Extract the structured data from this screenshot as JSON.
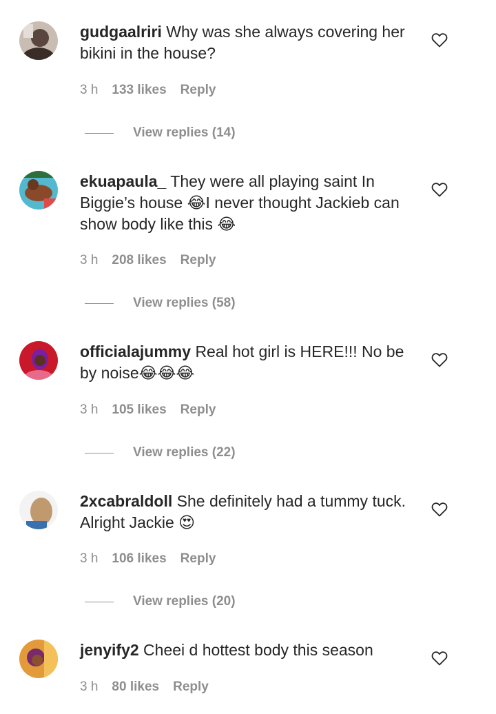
{
  "comments": [
    {
      "username": "gudgaalriri",
      "text": "Why was she always covering her bikini in the house?",
      "time": "3 h",
      "likes": "133 likes",
      "reply_label": "Reply",
      "view_replies": "View replies (14)",
      "avatar_colors": [
        "#b9a9a0",
        "#3a2d28",
        "#e0d6cf"
      ]
    },
    {
      "username": "ekuapaula_",
      "text": "They were all playing saint In Biggie’s house 😂I never thought Jackieb can show body like this 😂",
      "time": "3 h",
      "likes": "208 likes",
      "reply_label": "Reply",
      "view_replies": "View replies (58)",
      "avatar_colors": [
        "#4fb3c8",
        "#8a4a2a",
        "#2d7fa0"
      ]
    },
    {
      "username": "officialajummy",
      "text": "Real hot girl is HERE!!! No be by noise😂😂😂",
      "time": "3 h",
      "likes": "105 likes",
      "reply_label": "Reply",
      "view_replies": "View replies (22)",
      "avatar_colors": [
        "#d0202a",
        "#7a1fa0",
        "#f07a90"
      ]
    },
    {
      "username": "2xcabraldoll",
      "text": "She definitely had a tummy tuck. Alright Jackie 😍",
      "time": "3 h",
      "likes": "106 likes",
      "reply_label": "Reply",
      "view_replies": "View replies (20)",
      "avatar_colors": [
        "#f2f2f2",
        "#b0895e",
        "#3a6fb0"
      ]
    },
    {
      "username": "jenyify2",
      "text": "Cheei d hottest body this season",
      "time": "3 h",
      "likes": "80 likes",
      "reply_label": "Reply",
      "avatar_colors": [
        "#e08a2a",
        "#7a2a6a",
        "#f4c05a"
      ]
    }
  ],
  "colors": {
    "text": "#262626",
    "muted": "#8e8e8e",
    "background": "#ffffff"
  }
}
